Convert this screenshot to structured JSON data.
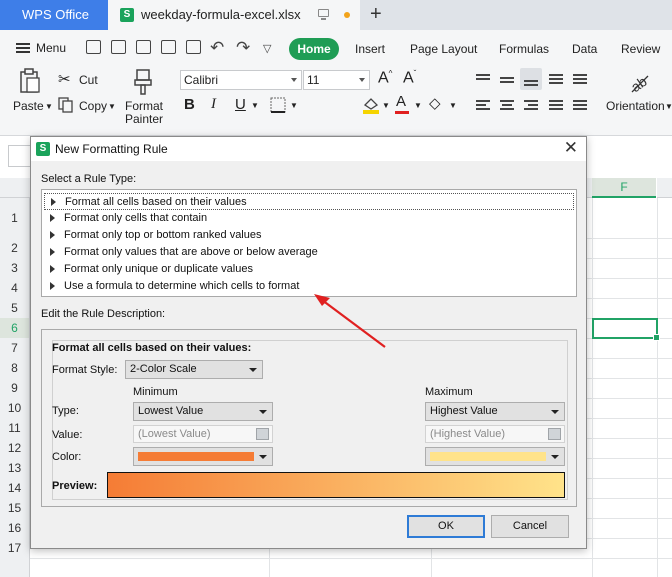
{
  "tabbar": {
    "app_tab": "WPS Office",
    "file_tab": "weekday-formula-excel.xlsx",
    "new_tab_glyph": "+"
  },
  "menubar": {
    "menu_label": "Menu",
    "tabs": [
      "Home",
      "Insert",
      "Page Layout",
      "Formulas",
      "Data",
      "Review"
    ],
    "active_tab": "Home"
  },
  "ribbon": {
    "paste": "Paste",
    "cut": "Cut",
    "copy": "Copy",
    "format_painter_line1": "Format",
    "format_painter_line2": "Painter",
    "font_name": "Calibri",
    "font_size": "11",
    "bold": "B",
    "italic": "I",
    "underline": "U",
    "orientation": "Orientation"
  },
  "sheet": {
    "active_column": "F",
    "rows": [
      "1",
      "2",
      "3",
      "4",
      "5",
      "6",
      "7",
      "8",
      "9",
      "10",
      "11",
      "12",
      "13",
      "14",
      "15",
      "16",
      "17"
    ],
    "active_row": "6"
  },
  "dialog": {
    "title": "New Formatting Rule",
    "select_rule_type_label": "Select a Rule Type:",
    "rule_types": [
      "Format all cells based on their values",
      "Format only cells that contain",
      "Format only top or bottom ranked values",
      "Format only values that are above or below average",
      "Format only unique or duplicate values",
      "Use a formula to determine which cells to format"
    ],
    "edit_description_label": "Edit the Rule Description:",
    "description_title": "Format all cells based on their values:",
    "format_style_label": "Format Style:",
    "format_style_value": "2-Color Scale",
    "minimum_header": "Minimum",
    "maximum_header": "Maximum",
    "type_label": "Type:",
    "value_label": "Value:",
    "color_label": "Color:",
    "preview_label": "Preview:",
    "min_type": "Lowest Value",
    "max_type": "Highest Value",
    "min_value_placeholder": "(Lowest Value)",
    "max_value_placeholder": "(Highest Value)",
    "min_color": "#f57c35",
    "max_color": "#ffe38a",
    "ok": "OK",
    "cancel": "Cancel"
  },
  "colors": {
    "wps_blue": "#3e7ee8",
    "home_green": "#1f9d55",
    "annotation_red": "#e02020"
  }
}
